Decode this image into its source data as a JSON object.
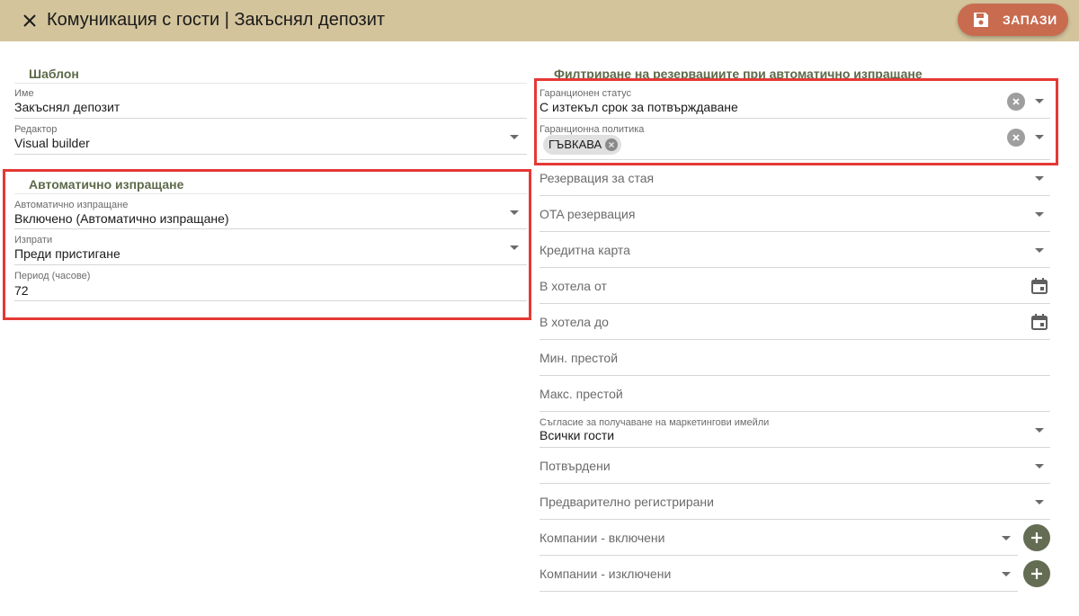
{
  "header": {
    "title": "Комуникация с гости | Закъснял депозит",
    "save_label": "ЗАПАЗИ",
    "background_color": "#d3c49c",
    "save_color": "#c96b4f",
    "close_icon": "close-icon",
    "save_icon": "floppy-disk-icon"
  },
  "template": {
    "section_title": "Шаблон",
    "name_label": "Име",
    "name_value": "Закъснял депозит",
    "editor_label": "Редактор",
    "editor_value": "Visual builder"
  },
  "auto_send": {
    "section_title": "Автоматично изпращане",
    "auto_label": "Автоматично изпращане",
    "auto_value": "Включено (Автоматично изпращане)",
    "send_label": "Изпрати",
    "send_value": "Преди пристигане",
    "period_label": "Период (часове)",
    "period_value": "72"
  },
  "filters": {
    "section_title": "Филтриране на резервациите при автоматично изпращане",
    "guarantee_status_label": "Гаранционен статус",
    "guarantee_status_value": "С изтекъл срок за потвърждаване",
    "guarantee_policy_label": "Гаранционна политика",
    "guarantee_policy_chip": "ГЪВКАВА",
    "room_reservation": "Резервация за стая",
    "ota_reservation": "OTA резервация",
    "credit_card": "Кредитна карта",
    "in_hotel_from": "В хотела от",
    "in_hotel_to": "В хотела до",
    "min_stay": "Мин. престой",
    "max_stay": "Макс. престой",
    "marketing_label": "Съгласие за получаване на маркетингови имейли",
    "marketing_value": "Всички гости",
    "confirmed": "Потвърдени",
    "preregistered": "Предварително регистрирани",
    "companies_included": "Компании - включени",
    "companies_excluded": "Компании - изключени"
  },
  "colors": {
    "section_title": "#5d6a4a",
    "highlight": "#e53935",
    "plus_button": "#646c53"
  }
}
